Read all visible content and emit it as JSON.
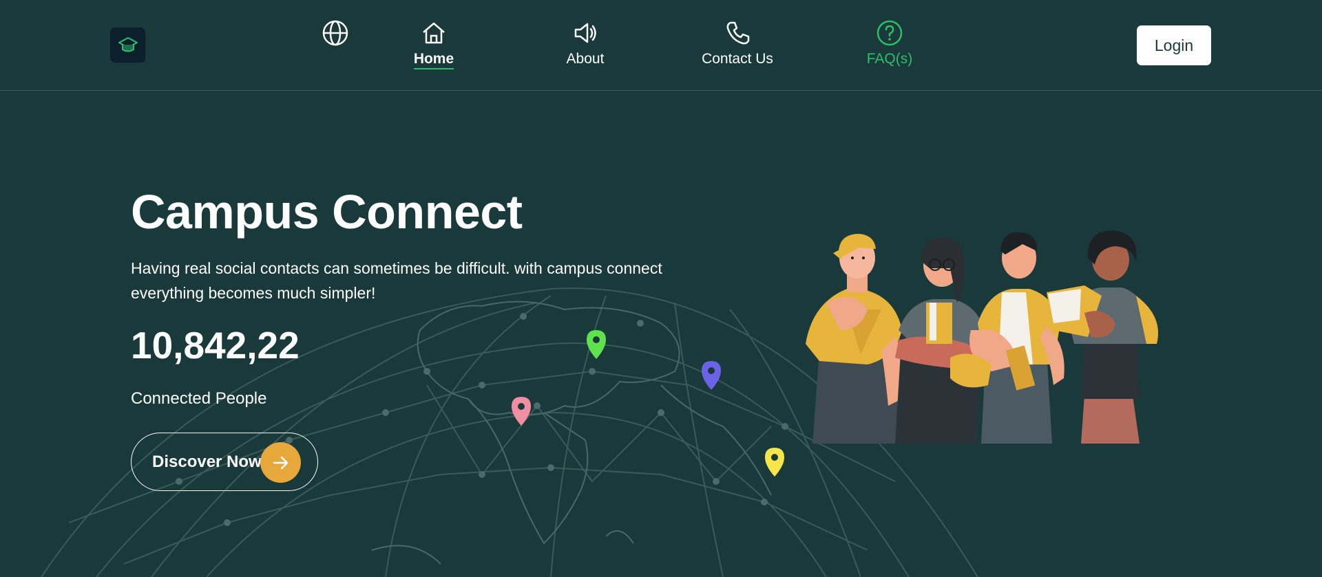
{
  "nav": {
    "items": [
      {
        "label": "Home",
        "icon": "home-icon",
        "active": true
      },
      {
        "label": "About",
        "icon": "megaphone-icon"
      },
      {
        "label": "Contact Us",
        "icon": "phone-icon"
      },
      {
        "label": "FAQ(s)",
        "icon": "question-circle-icon",
        "color": "#2fbf6a"
      }
    ],
    "login_label": "Login"
  },
  "hero": {
    "title": "Campus Connect",
    "description": "Having real social contacts can sometimes be difficult. with campus connect everything becomes much simpler!",
    "count": "10,842,22",
    "count_label": "Connected People",
    "cta_label": "Discover Now"
  },
  "colors": {
    "background": "#19393a",
    "accent_green": "#2fbf6a",
    "cta_orange": "#e6a83b",
    "pin_pink": "#f28ea1",
    "pin_green": "#5ee34f",
    "pin_blue": "#6b63e6",
    "pin_yellow": "#f5e64a"
  },
  "map_pins": [
    "pin-pink",
    "pin-green",
    "pin-blue",
    "pin-yellow"
  ]
}
